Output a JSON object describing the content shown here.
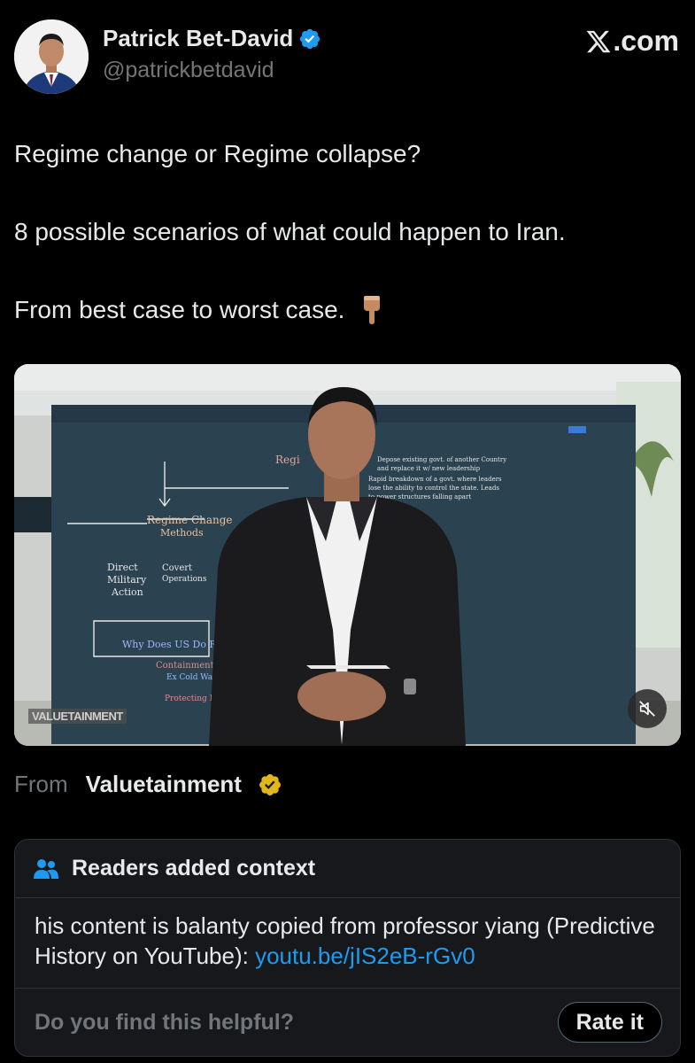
{
  "author": {
    "name": "Patrick Bet-David",
    "handle": "@patrickbetdavid",
    "verified_color": "#1d9bf0"
  },
  "site_label": ".com",
  "tweet": {
    "line1": "Regime change or Regime collapse?",
    "line2": "8 possible scenarios of what could happen to Iran.",
    "line3": "From best case to worst case."
  },
  "media": {
    "watermark": "VALUETAINMENT",
    "board_lines": {
      "header": "Regi",
      "methods": "Regime Change\nMethods",
      "direct": "Direct\nMilitary\nAction",
      "covert": "Covert\nOperations",
      "why": "Why Does US Do R",
      "contain": "Containment",
      "coldwar": "Ex Cold Wa",
      "protect": "Protecting Economic",
      "note1": "Depose existing govt. of another Country and replace it w/ new leadership",
      "note2": "Rapid breakdown of a govt. where leaders lose the ability to control the state. Leads to power structures falling apart"
    },
    "mute_icon": "muted-speaker-icon"
  },
  "attribution": {
    "from_label": "From",
    "source_name": "Valuetainment",
    "verified_color": "#e2b719"
  },
  "context": {
    "title": "Readers added context",
    "body_text": "his content is balanty copied from professor yiang (Predictive History on YouTube): ",
    "link_text": "youtu.be/jIS2eB-rGv0",
    "question": "Do you find this helpful?",
    "rate_label": "Rate it"
  }
}
